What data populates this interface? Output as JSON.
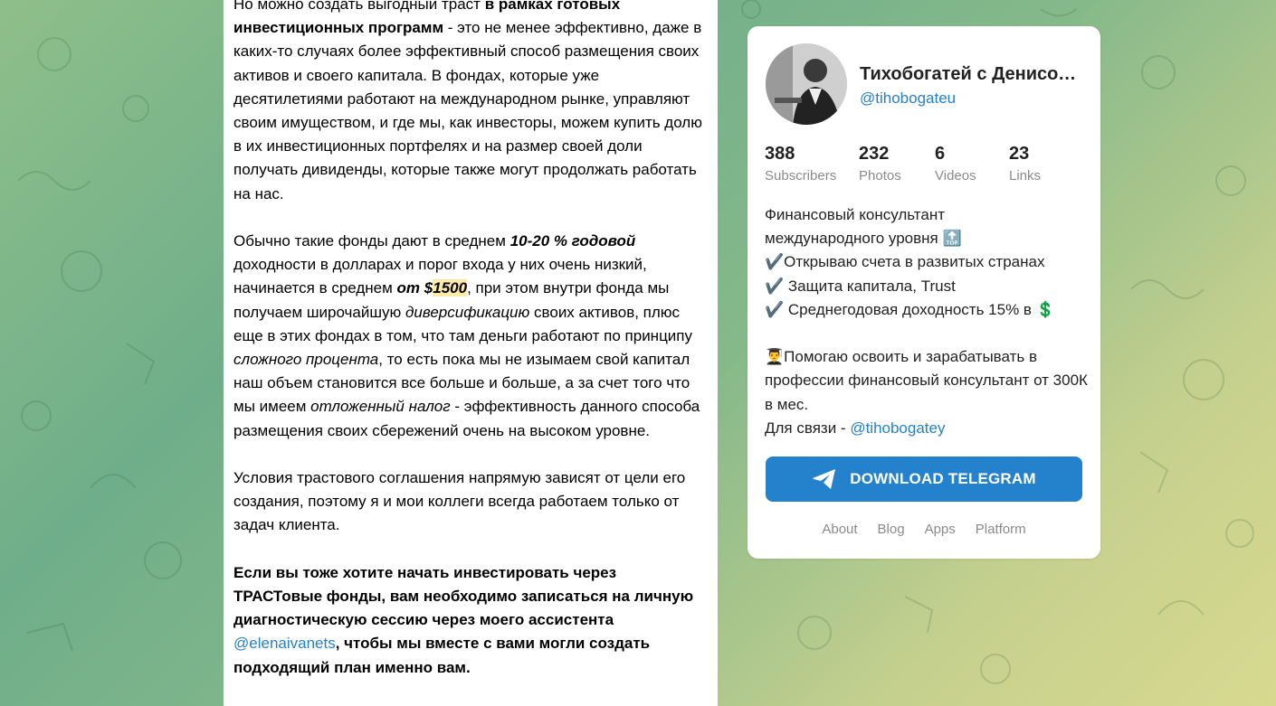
{
  "post": {
    "p1_a": "Но можно создать выгодный траст ",
    "p1_b": "в рамках готовых инвестиционных программ",
    "p1_c": " - это не менее эффективно, даже в каких-то случаях более эффективный способ размещения своих активов и своего капитала. В фондах, которые уже десятилетиями работают на международном рынке, управляют своим имуществом, и где мы, как инвесторы, можем купить долю в их инвестиционных портфелях и на размер своей доли получать дивиденды, которые также могут продолжать работать на нас.",
    "p2_a": "Обычно такие фонды дают в среднем ",
    "p2_b": "10-20 % годовой",
    "p2_c": " доходности в долларах и порог входа у них очень низкий, начинается в среднем ",
    "p2_d": "от $",
    "p2_e": "1500",
    "p2_f": ", при этом внутри фонда мы получаем широчайшую ",
    "p2_g": "диверсификацию",
    "p2_h": " своих активов, плюс еще в этих фондах в том, что там деньги работают по принципу ",
    "p2_i": "сложного процента",
    "p2_j": ", то есть пока мы не изымаем свой капитал наш объем становится все больше и больше, а за счет того что мы имеем ",
    "p2_k": "отложенный налог",
    "p2_l": " - эффективность данного способа размещения своих сбережений очень на высоком уровне.",
    "p3": "Условия трастового соглашения напрямую зависят от цели его создания, поэтому я и мои коллеги всегда работаем только от задач клиента.",
    "p4_a": "Если вы тоже хотите начать инвестировать через ТРАСТовые фонды, вам необходимо записаться на личную диагностическую сессию через моего ассистента ",
    "p4_link": "@elenaivanets",
    "p4_b": ", чтобы мы вместе с вами могли создать подходящий план именно вам."
  },
  "channel": {
    "title": "Тихобогатей с Денисом …",
    "username": "@tihobogateu",
    "stats": [
      {
        "num": "388",
        "label": "Subscribers"
      },
      {
        "num": "232",
        "label": "Photos"
      },
      {
        "num": "6",
        "label": "Videos"
      },
      {
        "num": "23",
        "label": "Links"
      }
    ],
    "desc": {
      "l1": "Финансовый консультант",
      "l2": "международного уровня ",
      "l2_icon": "🔝",
      "l3_icon": "✔️",
      "l3": "Открываю счета в развитых странах",
      "l4_icon": "✔️",
      "l4": " Защита капитала, Trust",
      "l5_icon": "✔️",
      "l5": " Среднегодовая доходность 15% в ",
      "l5_icon2": "💲",
      "l6_icon": "👨‍🎓",
      "l6": "Помогаю освоить и зарабатывать в профессии финансовый консультант от 300К в мес.",
      "l7": "Для связи - ",
      "l7_link": "@tihobogatey"
    },
    "download_label": "DOWNLOAD TELEGRAM",
    "footer": [
      "About",
      "Blog",
      "Apps",
      "Platform"
    ]
  },
  "colors": {
    "accent": "#2481cc",
    "highlight": "#fdeaa7"
  }
}
